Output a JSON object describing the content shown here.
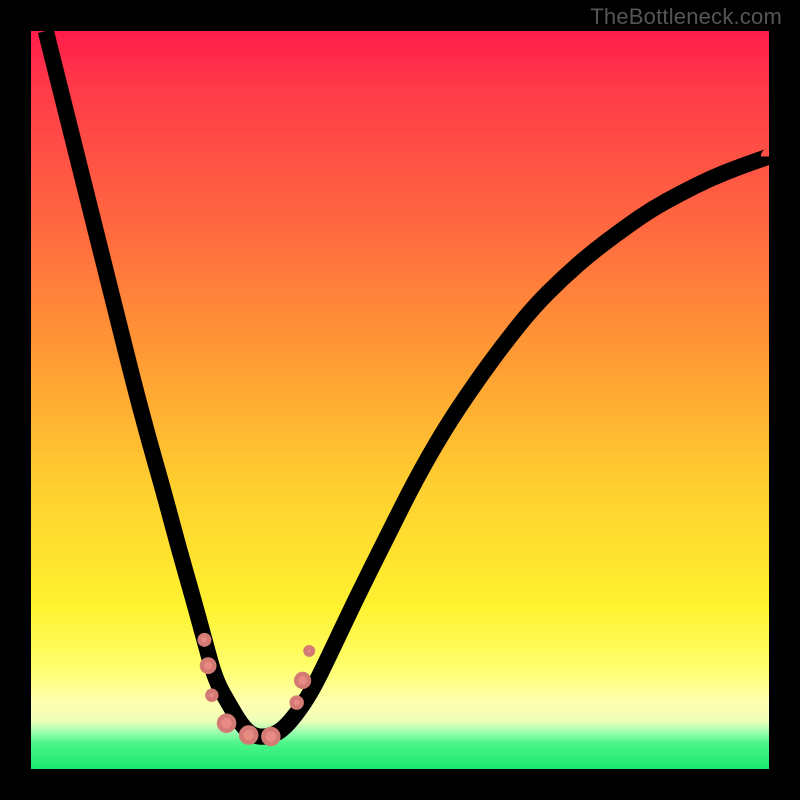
{
  "watermark": "TheBottleneck.com",
  "chart_data": {
    "type": "line",
    "title": "",
    "xlabel": "",
    "ylabel": "",
    "xlim": [
      0,
      100
    ],
    "ylim": [
      0,
      100
    ],
    "grid": false,
    "legend": false,
    "series": [
      {
        "name": "curve",
        "x": [
          2,
          4,
          6,
          8,
          10,
          12,
          14,
          16,
          18,
          20,
          22,
          23.5,
          25,
          27,
          28.5,
          30,
          32,
          34,
          36,
          38,
          40,
          44,
          48,
          52,
          56,
          60,
          64,
          68,
          72,
          76,
          80,
          84,
          88,
          92,
          96,
          100
        ],
        "y": [
          100,
          92,
          84,
          76,
          68,
          60,
          52,
          44.5,
          37.5,
          30,
          23,
          17.5,
          12,
          8.5,
          6,
          4.5,
          4.3,
          5.2,
          7.5,
          10.5,
          14.5,
          23,
          31,
          39,
          46,
          52,
          57.5,
          62.5,
          66.5,
          70,
          73,
          75.8,
          78,
          80,
          81.6,
          83
        ]
      }
    ],
    "markers": {
      "name": "data-points",
      "points": [
        {
          "x": 23.5,
          "y": 17.5,
          "r": 4.8
        },
        {
          "x": 24.0,
          "y": 14.0,
          "r": 6.2
        },
        {
          "x": 24.5,
          "y": 10.0,
          "r": 4.5
        },
        {
          "x": 26.5,
          "y": 6.2,
          "r": 7.5
        },
        {
          "x": 29.5,
          "y": 4.6,
          "r": 7.5
        },
        {
          "x": 32.5,
          "y": 4.4,
          "r": 7.5
        },
        {
          "x": 36.0,
          "y": 9.0,
          "r": 5.0
        },
        {
          "x": 36.8,
          "y": 12.0,
          "r": 6.4
        },
        {
          "x": 37.7,
          "y": 16.0,
          "r": 3.8
        }
      ]
    },
    "gradient_stops": [
      {
        "pos": 0.0,
        "color": "#ff1d4a"
      },
      {
        "pos": 0.44,
        "color": "#ff9a34"
      },
      {
        "pos": 0.78,
        "color": "#fff22f"
      },
      {
        "pos": 0.95,
        "color": "#9dffb0"
      },
      {
        "pos": 1.0,
        "color": "#18e86f"
      }
    ]
  }
}
